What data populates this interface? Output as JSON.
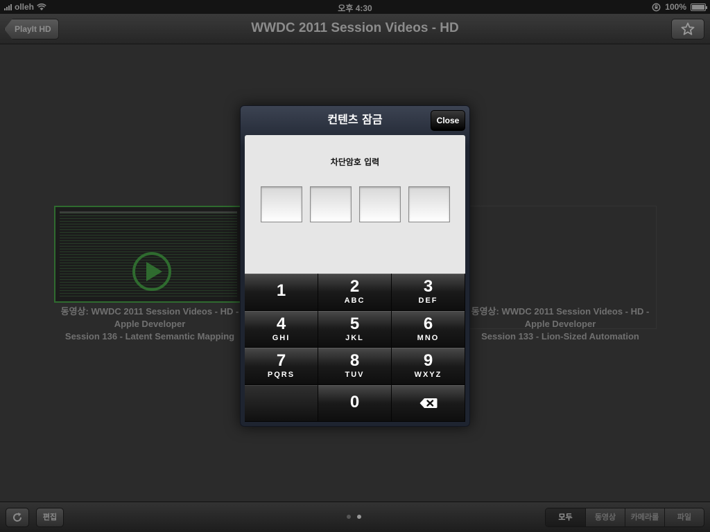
{
  "status_bar": {
    "carrier": "olleh",
    "time": "오후 4:30",
    "battery_text": "100%",
    "battery_level": 1.0
  },
  "nav": {
    "back_label": "PlayIt HD",
    "title": "WWDC 2011 Session Videos - HD",
    "star_icon": "star-icon"
  },
  "grid": {
    "items": [
      {
        "line1": "동영상: WWDC 2011 Session Videos - HD -",
        "line2": "Apple Developer",
        "line3": "Session 136 - Latent Semantic Mapping"
      },
      {
        "line1": "동영상: WWDC 2011 Session Videos - HD -",
        "line2": "Apple Developer",
        "line3": "Session 133 - Lion-Sized Automation"
      }
    ]
  },
  "modal": {
    "title": "컨텐츠 잠금",
    "close_label": "Close",
    "prompt": "차단암호 입력",
    "code_boxes": [
      "",
      "",
      "",
      ""
    ],
    "keypad": [
      {
        "num": "1",
        "letters": ""
      },
      {
        "num": "2",
        "letters": "ABC"
      },
      {
        "num": "3",
        "letters": "DEF"
      },
      {
        "num": "4",
        "letters": "GHI"
      },
      {
        "num": "5",
        "letters": "JKL"
      },
      {
        "num": "6",
        "letters": "MNO"
      },
      {
        "num": "7",
        "letters": "PQRS"
      },
      {
        "num": "8",
        "letters": "TUV"
      },
      {
        "num": "9",
        "letters": "WXYZ"
      },
      {
        "num": "",
        "letters": ""
      },
      {
        "num": "0",
        "letters": ""
      },
      {
        "num": "",
        "letters": "",
        "icon": "backspace-icon"
      }
    ]
  },
  "toolbar": {
    "refresh_icon": "refresh-icon",
    "edit_label": "편집",
    "pages": 2,
    "current_page": 2,
    "segments": [
      "모두",
      "동영상",
      "카메라롤",
      "파일"
    ],
    "selected_segment": 0
  },
  "colors": {
    "background": "#2b2b2b",
    "modal_header": "#1e2430",
    "thumb_border": "#2f6b2f"
  }
}
